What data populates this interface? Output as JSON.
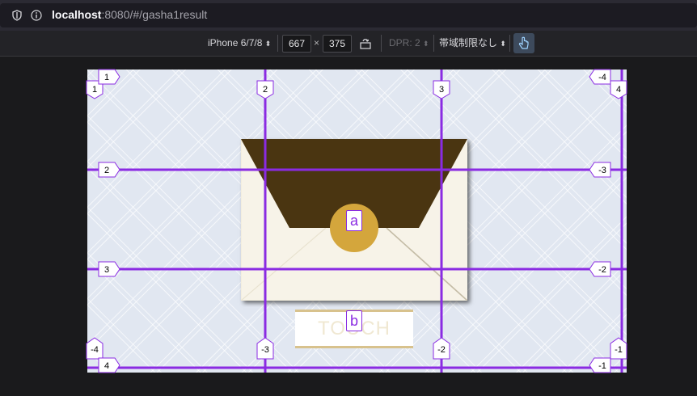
{
  "browser": {
    "url_host": "localhost",
    "url_rest": ":8080/#/gasha1result"
  },
  "rdm": {
    "device": "iPhone 6/7/8",
    "width": "667",
    "times": "×",
    "height": "375",
    "dpr": "DPR: 2",
    "throttle": "帯域制限なし"
  },
  "game": {
    "touch_label": "TOUCH",
    "marker_a": "a",
    "marker_b": "b",
    "colors": {
      "background": "#e1e7f1",
      "envelope": "#f7f3e8",
      "flap": "#4a3511",
      "seal": "#d4a63c",
      "guide": "#8a2be2"
    }
  },
  "guides": {
    "vertical": [
      "1",
      "2",
      "3",
      "4"
    ],
    "vertical_bottom": [
      "4",
      "-3",
      "-2",
      "-1"
    ],
    "horizontal_left": [
      "1",
      "2",
      "3",
      "-4"
    ],
    "horizontal_right": [
      "4",
      "-3",
      "-2",
      "-1"
    ],
    "top_right": "-4"
  }
}
